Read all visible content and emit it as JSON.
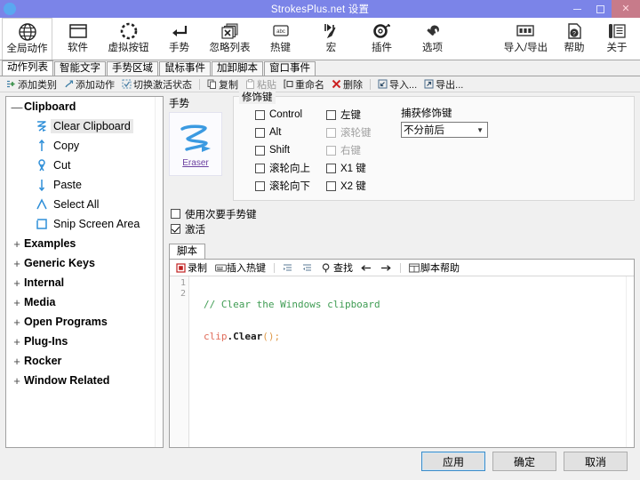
{
  "window": {
    "title": "StrokesPlus.net 设置",
    "icon": "app-globe-icon",
    "minimize": "minimize-button",
    "maximize": "maximize-button",
    "close": "close-button",
    "titlebar_color": "#7b84e8",
    "close_color": "#c77b8a"
  },
  "ribbon": {
    "left_items": [
      {
        "label": "全局动作",
        "icon": "globe-icon",
        "selected": true
      },
      {
        "label": "软件",
        "icon": "window-icon",
        "selected": false
      },
      {
        "label": "虚拟按钮",
        "icon": "dotted-circle-icon",
        "selected": false
      },
      {
        "label": "手势",
        "icon": "arrow-turn-icon",
        "selected": false
      },
      {
        "label": "忽略列表",
        "icon": "stacked-x-icon",
        "selected": false
      },
      {
        "label": "热键",
        "icon": "abc-key-icon",
        "selected": false
      },
      {
        "label": "宏",
        "icon": "macro-pencil-icon",
        "selected": false
      },
      {
        "label": "插件",
        "icon": "plugin-gear-icon",
        "selected": false
      },
      {
        "label": "选项",
        "icon": "wrench-icon",
        "selected": false
      }
    ],
    "right_items": [
      {
        "label": "导入/导出",
        "icon": "import-export-icon"
      },
      {
        "label": "帮助",
        "icon": "help-question-icon"
      },
      {
        "label": "关于",
        "icon": "about-info-icon"
      }
    ]
  },
  "tabs": [
    {
      "label": "动作列表",
      "active": true
    },
    {
      "label": "智能文字",
      "active": false
    },
    {
      "label": "手势区域",
      "active": false
    },
    {
      "label": "鼠标事件",
      "active": false
    },
    {
      "label": "加卸脚本",
      "active": false
    },
    {
      "label": "窗口事件",
      "active": false
    }
  ],
  "commandbar": [
    {
      "label": "添加类别",
      "icon": "add-category-icon",
      "disabled": false
    },
    {
      "label": "添加动作",
      "icon": "add-action-icon",
      "disabled": false
    },
    {
      "label": "切换激活状态",
      "icon": "toggle-enabled-icon",
      "disabled": false
    },
    {
      "label": "复制",
      "icon": "copy-icon",
      "disabled": false
    },
    {
      "label": "粘贴",
      "icon": "paste-icon",
      "disabled": true
    },
    {
      "label": "重命名",
      "icon": "rename-icon",
      "disabled": false
    },
    {
      "label": "删除",
      "icon": "delete-x-icon",
      "disabled": false
    },
    {
      "label": "导入...",
      "icon": "import-icon",
      "disabled": false
    },
    {
      "label": "导出...",
      "icon": "export-icon",
      "disabled": false
    }
  ],
  "tree": {
    "expanded_group": {
      "label": "Clipboard",
      "expander": "minus",
      "children": [
        {
          "label": "Clear Clipboard",
          "icon": "gesture-zigzag-icon",
          "selected": true
        },
        {
          "label": "Copy",
          "icon": "gesture-up-arrow-icon",
          "selected": false
        },
        {
          "label": "Cut",
          "icon": "gesture-loop-icon",
          "selected": false
        },
        {
          "label": "Paste",
          "icon": "gesture-down-arrow-icon",
          "selected": false
        },
        {
          "label": "Select All",
          "icon": "gesture-caret-icon",
          "selected": false
        },
        {
          "label": "Snip Screen Area",
          "icon": "gesture-square-icon",
          "selected": false
        }
      ]
    },
    "collapsed_groups": [
      {
        "label": "Examples",
        "expander": "plus"
      },
      {
        "label": "Generic Keys",
        "expander": "plus"
      },
      {
        "label": "Internal",
        "expander": "plus"
      },
      {
        "label": "Media",
        "expander": "plus"
      },
      {
        "label": "Open Programs",
        "expander": "plus"
      },
      {
        "label": "Plug-Ins",
        "expander": "plus"
      },
      {
        "label": "Rocker",
        "expander": "plus"
      },
      {
        "label": "Window Related",
        "expander": "plus"
      }
    ]
  },
  "gesture": {
    "title": "手势",
    "name": "Eraser",
    "icon": "gesture-zigzag-preview"
  },
  "modifiers": {
    "legend": "修饰键",
    "column1": [
      {
        "label": "Control",
        "checked": false,
        "disabled": false
      },
      {
        "label": "Alt",
        "checked": false,
        "disabled": false
      },
      {
        "label": "Shift",
        "checked": false,
        "disabled": false
      },
      {
        "label": "滚轮向上",
        "checked": false,
        "disabled": false
      },
      {
        "label": "滚轮向下",
        "checked": false,
        "disabled": false
      }
    ],
    "column2": [
      {
        "label": "左键",
        "checked": false,
        "disabled": false
      },
      {
        "label": "滚轮键",
        "checked": false,
        "disabled": true
      },
      {
        "label": "右键",
        "checked": false,
        "disabled": true
      },
      {
        "label": "X1 键",
        "checked": false,
        "disabled": false
      },
      {
        "label": "X2 键",
        "checked": false,
        "disabled": false
      }
    ],
    "capture": {
      "label": "捕获修饰键",
      "value": "不分前后"
    }
  },
  "options": [
    {
      "label": "使用次要手势键",
      "checked": false
    },
    {
      "label": "激活",
      "checked": true
    }
  ],
  "script": {
    "tab_label": "脚本",
    "toolbar": [
      {
        "label": "录制",
        "icon": "record-icon"
      },
      {
        "label": "插入热键",
        "icon": "insert-hotkey-icon"
      },
      {
        "label": "",
        "icon": "indent-icon"
      },
      {
        "label": "",
        "icon": "unindent-icon"
      },
      {
        "label": "查找",
        "icon": "search-icon"
      },
      {
        "label": "",
        "icon": "arrow-left-icon"
      },
      {
        "label": "",
        "icon": "arrow-right-icon"
      },
      {
        "label": "脚本帮助",
        "icon": "script-help-icon"
      }
    ],
    "lines": [
      {
        "number": "1",
        "comment": "// Clear the Windows clipboard"
      },
      {
        "number": "2",
        "obj": "clip",
        "dot": ".",
        "fn": "Clear",
        "punct": "();"
      }
    ]
  },
  "footer": {
    "apply": "应用",
    "ok": "确定",
    "cancel": "取消"
  }
}
